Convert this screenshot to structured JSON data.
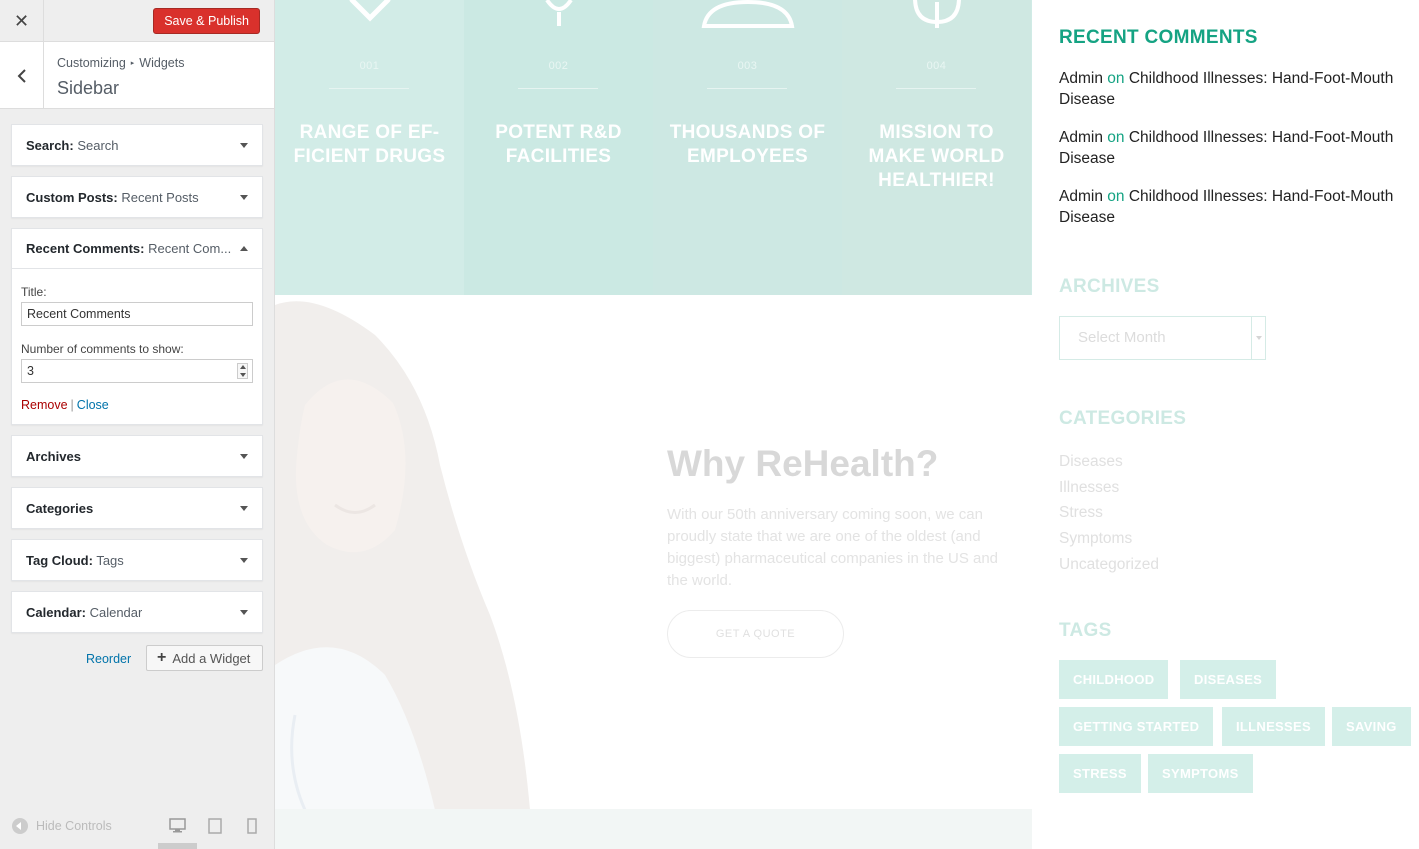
{
  "customizer": {
    "close_icon": "close-icon",
    "save_label": "Save & Publish",
    "breadcrumb": [
      "Customizing",
      "Widgets"
    ],
    "breadcrumb_separator": "▸",
    "panel_title": "Sidebar",
    "widgets": [
      {
        "type": "Search:",
        "title": "Search"
      },
      {
        "type": "Custom Posts:",
        "title": "Recent Posts"
      },
      {
        "type": "Recent Comments:",
        "title": "Recent Com..."
      },
      {
        "type": "Archives",
        "title": ""
      },
      {
        "type": "Categories",
        "title": ""
      },
      {
        "type": "Tag Cloud:",
        "title": "Tags"
      },
      {
        "type": "Calendar:",
        "title": "Calendar"
      }
    ],
    "open_widget": {
      "title_label": "Title:",
      "title_value": "Recent Comments",
      "count_label": "Number of comments to show:",
      "count_value": "3",
      "remove_label": "Remove",
      "separator": "|",
      "close_label": "Close"
    },
    "reorder_label": "Reorder",
    "add_widget_label": "Add a Widget",
    "hide_controls_label": "Hide Controls"
  },
  "preview": {
    "features": [
      {
        "num": "001",
        "label": "RANGE OF EF- FICIENT DRUGS"
      },
      {
        "num": "002",
        "label": "POTENT R&D FACILITIES"
      },
      {
        "num": "003",
        "label": "THOUSANDS OF EMPLOYEES"
      },
      {
        "num": "004",
        "label": "MISSION TO MAKE WORLD HEALTHIER!"
      }
    ],
    "why_title": "Why ReHealth?",
    "why_text": "With our 50th anniversary coming soon, we can proudly state that we are one of the oldest (and biggest) pharmaceutical companies in the US and the world.",
    "quote_button": "GET A QUOTE",
    "sidebar": {
      "recent_comments_title": "RECENT COMMENTS",
      "comments": [
        {
          "author": "Admin",
          "on": "on",
          "post": "Childhood Illnesses: Hand-Foot-Mouth Disease"
        },
        {
          "author": "Admin",
          "on": "on",
          "post": "Childhood Illnesses: Hand-Foot-Mouth Disease"
        },
        {
          "author": "Admin",
          "on": "on",
          "post": "Childhood Illnesses: Hand-Foot-Mouth Disease"
        }
      ],
      "archives_title": "ARCHIVES",
      "archives_select": "Select Month",
      "categories_title": "CATEGORIES",
      "categories": [
        "Diseases",
        "Illnesses",
        "Stress",
        "Symptoms",
        "Uncategorized"
      ],
      "tags_title": "TAGS",
      "tags": [
        "CHILDHOOD",
        "DISEASES",
        "GETTING STARTED",
        "ILLNESSES",
        "SAVING",
        "STRESS",
        "SYMPTOMS"
      ]
    }
  },
  "colors": {
    "accent_green": "#15a383",
    "hero_teal": "#d0ebe6",
    "publish_red": "#d9312c",
    "link_blue": "#0073aa",
    "remove_red": "#aa0000"
  }
}
